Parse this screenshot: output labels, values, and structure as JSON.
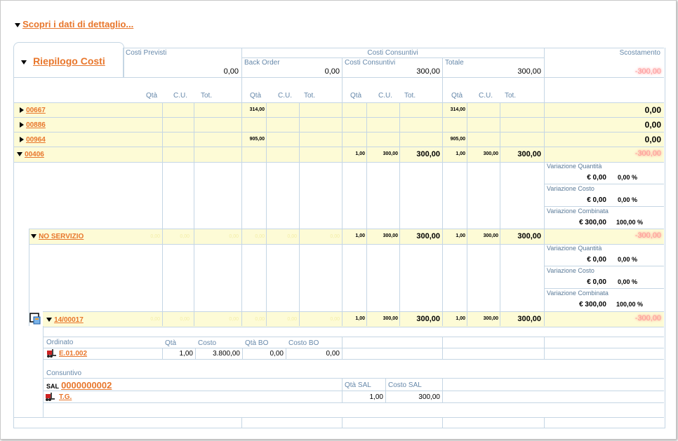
{
  "header": {
    "discover_label": "Scopri i dati di dettaglio...",
    "tab_label": "Riepilogo Costi"
  },
  "top": {
    "costi_previsti": "Costi Previsti",
    "costi_previsti_val": "0,00",
    "costi_consuntivi": "Costi Consuntivi",
    "back_order": "Back Order",
    "back_order_val": "0,00",
    "costi_cons_sub": "Costi Consuntivi",
    "costi_cons_val": "300,00",
    "totale": "Totale",
    "totale_val": "300,00",
    "scostamento": "Scostamento",
    "scostamento_val": "-300,00"
  },
  "col_headers": {
    "qta": "Qtà",
    "cu": "C.U.",
    "tot": "Tot."
  },
  "rows": [
    {
      "code": "00667",
      "bo_qta": "314,00",
      "tot_qta": "314,00",
      "scost": "0,00"
    },
    {
      "code": "00886",
      "scost": "0,00"
    },
    {
      "code": "00964",
      "bo_qta": "905,00",
      "tot_qta": "905,00",
      "scost": "0,00"
    },
    {
      "code": "00406",
      "c_qta": "1,00",
      "c_cu": "300,00",
      "c_tot": "300,00",
      "t_qta": "1,00",
      "t_cu": "300,00",
      "t_tot": "300,00",
      "scost": "-300,00"
    }
  ],
  "variazioni": {
    "quantita": "Variazione Quantità",
    "costo": "Variazione Costo",
    "combinata": "Variazione Combinata",
    "q_eur": "€ 0,00",
    "q_pct": "0,00 %",
    "c_eur": "€ 0,00",
    "c_pct": "0,00 %",
    "k_eur": "€ 300,00",
    "k_pct": "100,00 %"
  },
  "no_servizio": {
    "code": "NO SERVIZIO",
    "faint": "0,00",
    "c_qta": "1,00",
    "c_cu": "300,00",
    "c_tot": "300,00",
    "t_qta": "1,00",
    "t_cu": "300,00",
    "t_tot": "300,00",
    "scost": "-300,00"
  },
  "row14": {
    "code": "14/00017",
    "faint": "0,00",
    "c_qta": "1,00",
    "c_cu": "300,00",
    "c_tot": "300,00",
    "t_qta": "1,00",
    "t_cu": "300,00",
    "t_tot": "300,00",
    "scost": "-300,00"
  },
  "ordinato": {
    "label": "Ordinato",
    "qta": "Qtà",
    "costo": "Costo",
    "qta_bo": "Qtà BO",
    "costo_bo": "Costo BO",
    "item": "E.01.002",
    "v_qta": "1,00",
    "v_costo": "3.800,00",
    "v_qta_bo": "0,00",
    "v_costo_bo": "0,00"
  },
  "consuntivo": {
    "label": "Consuntivo",
    "sal_prefix": "SAL",
    "sal_code": "0000000002",
    "qta_sal": "Qtà SAL",
    "costo_sal": "Costo SAL",
    "item": "T.G.",
    "v_qta": "1,00",
    "v_costo": "300,00"
  },
  "colors": {
    "orange": "#e8762b",
    "row_bg": "#fdfbd6",
    "line": "#c5d6e4",
    "label": "#5a7a98"
  }
}
